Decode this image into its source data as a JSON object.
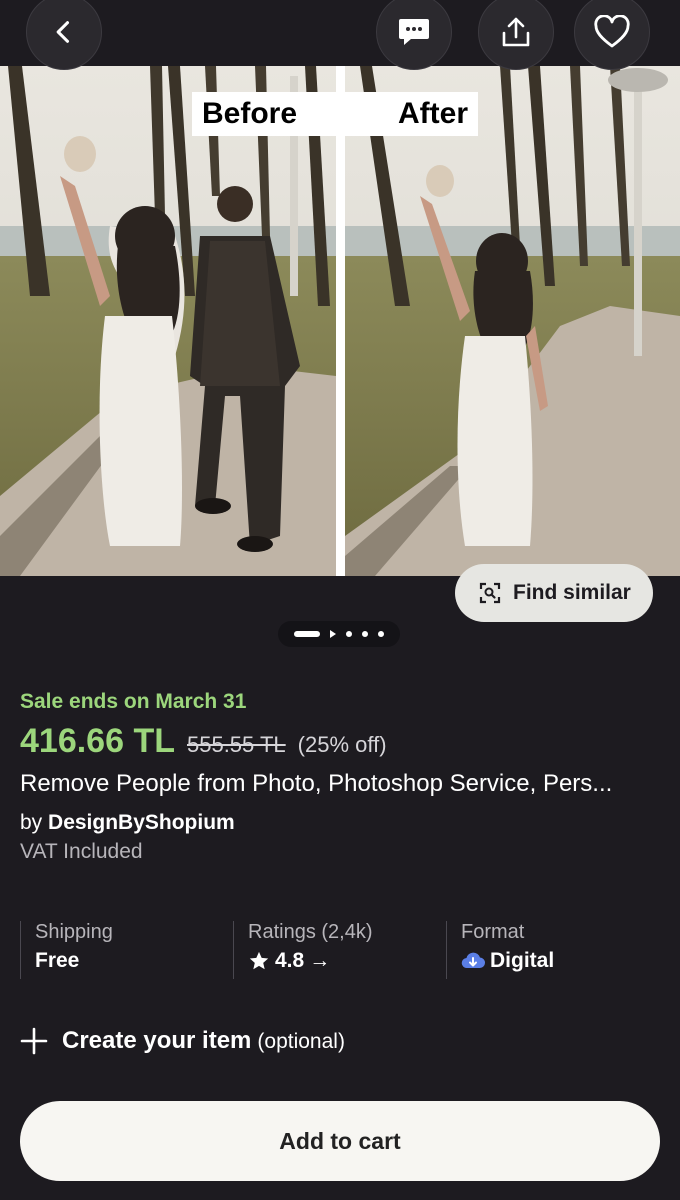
{
  "header": {
    "back_icon": "chevron-left-icon",
    "chat_icon": "chat-bubble-icon",
    "share_icon": "share-icon",
    "favorite_icon": "heart-icon"
  },
  "hero": {
    "label_before": "Before",
    "label_after": "After",
    "find_similar_label": "Find similar",
    "find_similar_icon": "visual-search-icon"
  },
  "pagination": {
    "total": 5,
    "current": 1
  },
  "listing": {
    "sale_text": "Sale ends on March 31",
    "price": "416.66 TL",
    "original_price": "555.55 TL",
    "discount": "(25% off)",
    "title": "Remove People from Photo, Photoshop Service, Pers...",
    "seller_prefix": "by",
    "seller_name": "DesignByShopium",
    "vat_text": "VAT Included"
  },
  "stats": {
    "shipping_label": "Shipping",
    "shipping_value": "Free",
    "ratings_label": "Ratings (2,4k)",
    "ratings_value": "4.8",
    "ratings_arrow": "→",
    "format_label": "Format",
    "format_value": "Digital"
  },
  "create": {
    "label": "Create your item",
    "optional": "(optional)"
  },
  "cart": {
    "label": "Add to cart"
  },
  "colors": {
    "background": "#1d1b20",
    "sale_green": "#9cd67c",
    "cart_button": "#f7f6f2"
  }
}
